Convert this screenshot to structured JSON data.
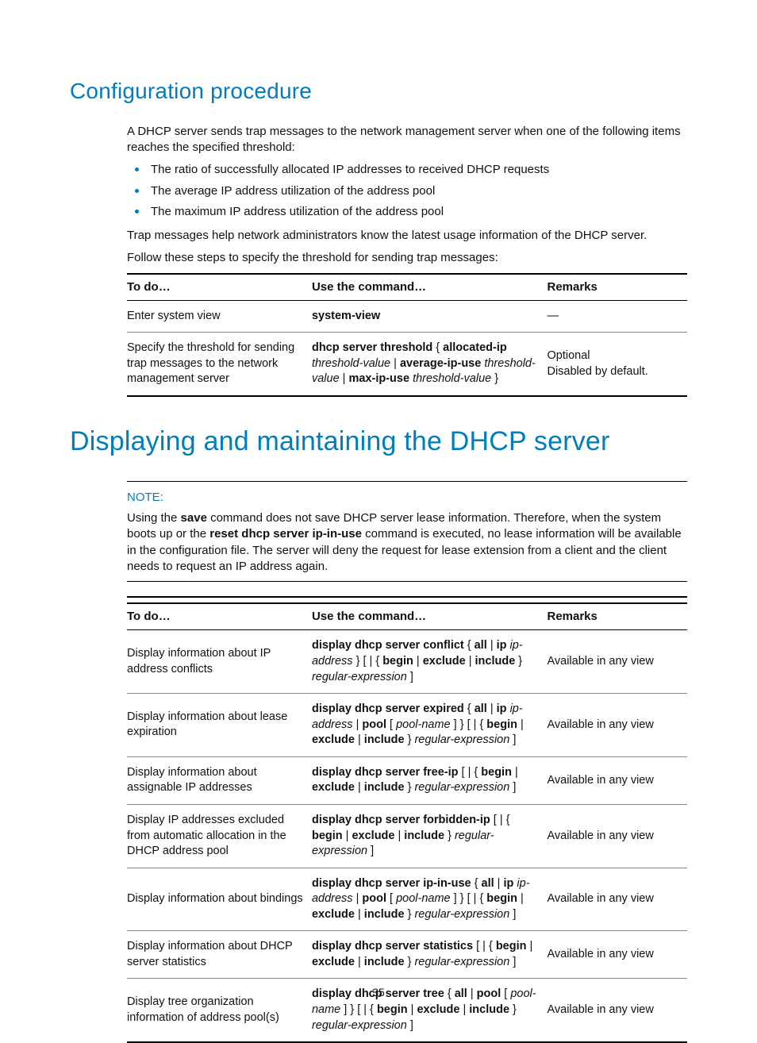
{
  "page_number": "35",
  "section1": {
    "heading": "Configuration procedure",
    "intro": "A DHCP server sends trap messages to the network management server when one of the following items reaches the specified threshold:",
    "bullets": [
      "The ratio of successfully allocated IP addresses to received DHCP requests",
      "The average IP address utilization of the address pool",
      "The maximum IP address utilization of the address pool"
    ],
    "after_bullets": "Trap messages help network administrators know the latest usage information of the DHCP server.",
    "lead_in": "Follow these steps to specify the threshold for sending trap messages:",
    "table": {
      "headers": [
        "To do…",
        "Use the command…",
        "Remarks"
      ],
      "rows": [
        {
          "todo": "Enter system view",
          "cmd_parts": [
            {
              "t": "system-view",
              "s": "b"
            }
          ],
          "remarks_parts": [
            {
              "t": "—",
              "s": ""
            }
          ]
        },
        {
          "todo": "Specify the threshold for sending trap messages to the network management server",
          "cmd_parts": [
            {
              "t": "dhcp server threshold",
              "s": "b"
            },
            {
              "t": " { ",
              "s": ""
            },
            {
              "t": "allocated-ip",
              "s": "b"
            },
            {
              "t": " ",
              "s": ""
            },
            {
              "t": "threshold-value",
              "s": "it"
            },
            {
              "t": " | ",
              "s": ""
            },
            {
              "t": "average-ip-use",
              "s": "b"
            },
            {
              "t": " ",
              "s": ""
            },
            {
              "t": "threshold-value",
              "s": "it"
            },
            {
              "t": " | ",
              "s": ""
            },
            {
              "t": "max-ip-use",
              "s": "b"
            },
            {
              "t": " ",
              "s": ""
            },
            {
              "t": "threshold-value",
              "s": "it"
            },
            {
              "t": " }",
              "s": ""
            }
          ],
          "remarks_parts": [
            {
              "t": "Optional",
              "s": ""
            },
            {
              "t": "\n",
              "s": "br"
            },
            {
              "t": "Disabled by default.",
              "s": ""
            }
          ]
        }
      ]
    }
  },
  "section2": {
    "heading": "Displaying and maintaining the DHCP server",
    "note_label": "NOTE:",
    "note_parts": [
      {
        "t": "Using the ",
        "s": ""
      },
      {
        "t": "save",
        "s": "b"
      },
      {
        "t": " command does not save DHCP server lease information. Therefore, when the system boots up or the ",
        "s": ""
      },
      {
        "t": "reset dhcp server ip-in-use",
        "s": "b"
      },
      {
        "t": " command is executed, no lease information will be available in the configuration file. The server will deny the request for lease extension from a client and the client needs to request an IP address again.",
        "s": ""
      }
    ],
    "table": {
      "headers": [
        "To do…",
        "Use the command…",
        "Remarks"
      ],
      "rows": [
        {
          "todo": "Display information about IP address conflicts",
          "cmd_parts": [
            {
              "t": "display dhcp server conflict",
              "s": "b"
            },
            {
              "t": " { ",
              "s": ""
            },
            {
              "t": "all",
              "s": "b"
            },
            {
              "t": " | ",
              "s": ""
            },
            {
              "t": "ip",
              "s": "b"
            },
            {
              "t": " ",
              "s": ""
            },
            {
              "t": "ip-address",
              "s": "it"
            },
            {
              "t": " } [ | { ",
              "s": ""
            },
            {
              "t": "begin",
              "s": "b"
            },
            {
              "t": " | ",
              "s": ""
            },
            {
              "t": "exclude",
              "s": "b"
            },
            {
              "t": " | ",
              "s": ""
            },
            {
              "t": "include",
              "s": "b"
            },
            {
              "t": " } ",
              "s": ""
            },
            {
              "t": "regular-expression",
              "s": "it"
            },
            {
              "t": " ]",
              "s": ""
            }
          ],
          "remarks": "Available in any view"
        },
        {
          "todo": "Display information about lease expiration",
          "cmd_parts": [
            {
              "t": "display dhcp server expired",
              "s": "b"
            },
            {
              "t": " { ",
              "s": ""
            },
            {
              "t": "all",
              "s": "b"
            },
            {
              "t": " | ",
              "s": ""
            },
            {
              "t": "ip",
              "s": "b"
            },
            {
              "t": " ",
              "s": ""
            },
            {
              "t": "ip-address",
              "s": "it"
            },
            {
              "t": " | ",
              "s": ""
            },
            {
              "t": "pool",
              "s": "b"
            },
            {
              "t": " [ ",
              "s": ""
            },
            {
              "t": "pool-name",
              "s": "it"
            },
            {
              "t": " ] } [ | { ",
              "s": ""
            },
            {
              "t": "begin",
              "s": "b"
            },
            {
              "t": " | ",
              "s": ""
            },
            {
              "t": "exclude",
              "s": "b"
            },
            {
              "t": " | ",
              "s": ""
            },
            {
              "t": "include",
              "s": "b"
            },
            {
              "t": " } ",
              "s": ""
            },
            {
              "t": "regular-expression",
              "s": "it"
            },
            {
              "t": " ]",
              "s": ""
            }
          ],
          "remarks": "Available in any view"
        },
        {
          "todo": "Display information about assignable IP addresses",
          "cmd_parts": [
            {
              "t": "display dhcp server free-ip",
              "s": "b"
            },
            {
              "t": " [ | { ",
              "s": ""
            },
            {
              "t": "begin",
              "s": "b"
            },
            {
              "t": " | ",
              "s": ""
            },
            {
              "t": "exclude",
              "s": "b"
            },
            {
              "t": " | ",
              "s": ""
            },
            {
              "t": "include",
              "s": "b"
            },
            {
              "t": " } ",
              "s": ""
            },
            {
              "t": "regular-expression",
              "s": "it"
            },
            {
              "t": " ]",
              "s": ""
            }
          ],
          "remarks": "Available in any view"
        },
        {
          "todo": "Display IP addresses excluded from automatic allocation in the DHCP address pool",
          "cmd_parts": [
            {
              "t": "display dhcp server forbidden-ip",
              "s": "b"
            },
            {
              "t": " [ | { ",
              "s": ""
            },
            {
              "t": "begin",
              "s": "b"
            },
            {
              "t": " | ",
              "s": ""
            },
            {
              "t": "exclude",
              "s": "b"
            },
            {
              "t": " | ",
              "s": ""
            },
            {
              "t": "include",
              "s": "b"
            },
            {
              "t": " } ",
              "s": ""
            },
            {
              "t": "regular-expression",
              "s": "it"
            },
            {
              "t": " ]",
              "s": ""
            }
          ],
          "remarks": "Available in any view"
        },
        {
          "todo": "Display information about bindings",
          "cmd_parts": [
            {
              "t": "display dhcp server ip-in-use",
              "s": "b"
            },
            {
              "t": " { ",
              "s": ""
            },
            {
              "t": "all",
              "s": "b"
            },
            {
              "t": " | ",
              "s": ""
            },
            {
              "t": "ip",
              "s": "b"
            },
            {
              "t": " ",
              "s": ""
            },
            {
              "t": "ip-address",
              "s": "it"
            },
            {
              "t": " | ",
              "s": ""
            },
            {
              "t": "pool",
              "s": "b"
            },
            {
              "t": " [ ",
              "s": ""
            },
            {
              "t": "pool-name",
              "s": "it"
            },
            {
              "t": " ] } [ | { ",
              "s": ""
            },
            {
              "t": "begin",
              "s": "b"
            },
            {
              "t": " | ",
              "s": ""
            },
            {
              "t": "exclude",
              "s": "b"
            },
            {
              "t": " | ",
              "s": ""
            },
            {
              "t": "include",
              "s": "b"
            },
            {
              "t": " } ",
              "s": ""
            },
            {
              "t": "regular-expression",
              "s": "it"
            },
            {
              "t": " ]",
              "s": ""
            }
          ],
          "remarks": "Available in any view"
        },
        {
          "todo": "Display information about DHCP server statistics",
          "cmd_parts": [
            {
              "t": "display dhcp server statistics",
              "s": "b"
            },
            {
              "t": " [ | { ",
              "s": ""
            },
            {
              "t": "begin",
              "s": "b"
            },
            {
              "t": " | ",
              "s": ""
            },
            {
              "t": "exclude",
              "s": "b"
            },
            {
              "t": " | ",
              "s": ""
            },
            {
              "t": "include",
              "s": "b"
            },
            {
              "t": " } ",
              "s": ""
            },
            {
              "t": "regular-expression",
              "s": "it"
            },
            {
              "t": " ]",
              "s": ""
            }
          ],
          "remarks": "Available in any view"
        },
        {
          "todo": "Display tree organization information of address pool(s)",
          "cmd_parts": [
            {
              "t": "display dhcp server tree",
              "s": "b"
            },
            {
              "t": " { ",
              "s": ""
            },
            {
              "t": "all",
              "s": "b"
            },
            {
              "t": " | ",
              "s": ""
            },
            {
              "t": "pool",
              "s": "b"
            },
            {
              "t": " [ ",
              "s": ""
            },
            {
              "t": "pool-name",
              "s": "it"
            },
            {
              "t": " ] } [ | { ",
              "s": ""
            },
            {
              "t": "begin",
              "s": "b"
            },
            {
              "t": " | ",
              "s": ""
            },
            {
              "t": "exclude",
              "s": "b"
            },
            {
              "t": " | ",
              "s": ""
            },
            {
              "t": "include",
              "s": "b"
            },
            {
              "t": " } ",
              "s": ""
            },
            {
              "t": "regular-expression",
              "s": "it"
            },
            {
              "t": " ]",
              "s": ""
            }
          ],
          "remarks": "Available in any view"
        }
      ]
    }
  }
}
